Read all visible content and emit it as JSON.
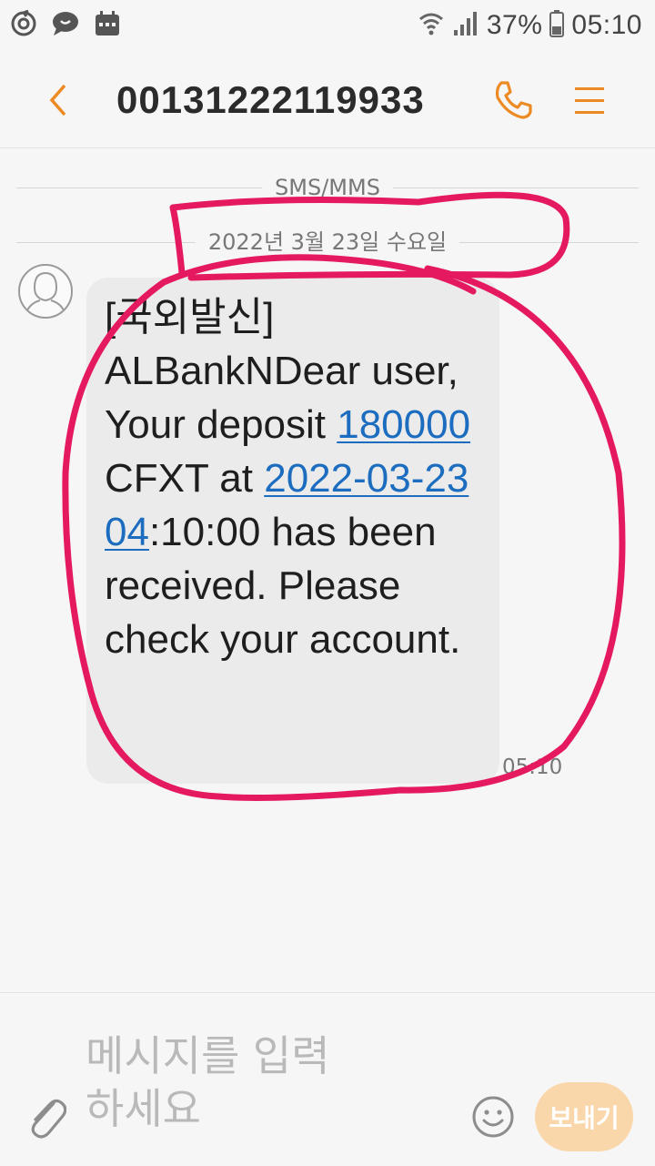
{
  "status_bar": {
    "battery": "37%",
    "time": "05:10",
    "icons": [
      "sync-icon",
      "chat-icon",
      "calendar-icon",
      "wifi-icon",
      "signal-icon",
      "battery-icon"
    ]
  },
  "header": {
    "back_icon": "chevron-left-icon",
    "title": "00131222119933",
    "call_icon": "phone-icon",
    "menu_icon": "menu-icon",
    "accent_color": "#ee8a24"
  },
  "conversation": {
    "channel_label": "SMS/MMS",
    "date_label": "2022년 3월 23일 수요일",
    "messages": [
      {
        "text_parts": [
          "[국외발신] ALBankNDear user, Your deposit ",
          "180000",
          " CFXT at ",
          "2022-03-23 04",
          ":10:00 has been received. Please check your account."
        ],
        "time": "05:10"
      }
    ],
    "annotation_color": "#e5195f",
    "link_color": "#1c6dbf"
  },
  "composer": {
    "placeholder": "메시지를 입력하세요",
    "send_label": "보내기",
    "attach_icon": "paperclip-icon",
    "emoji_icon": "smiley-icon",
    "send_color": "#fad7aa"
  }
}
